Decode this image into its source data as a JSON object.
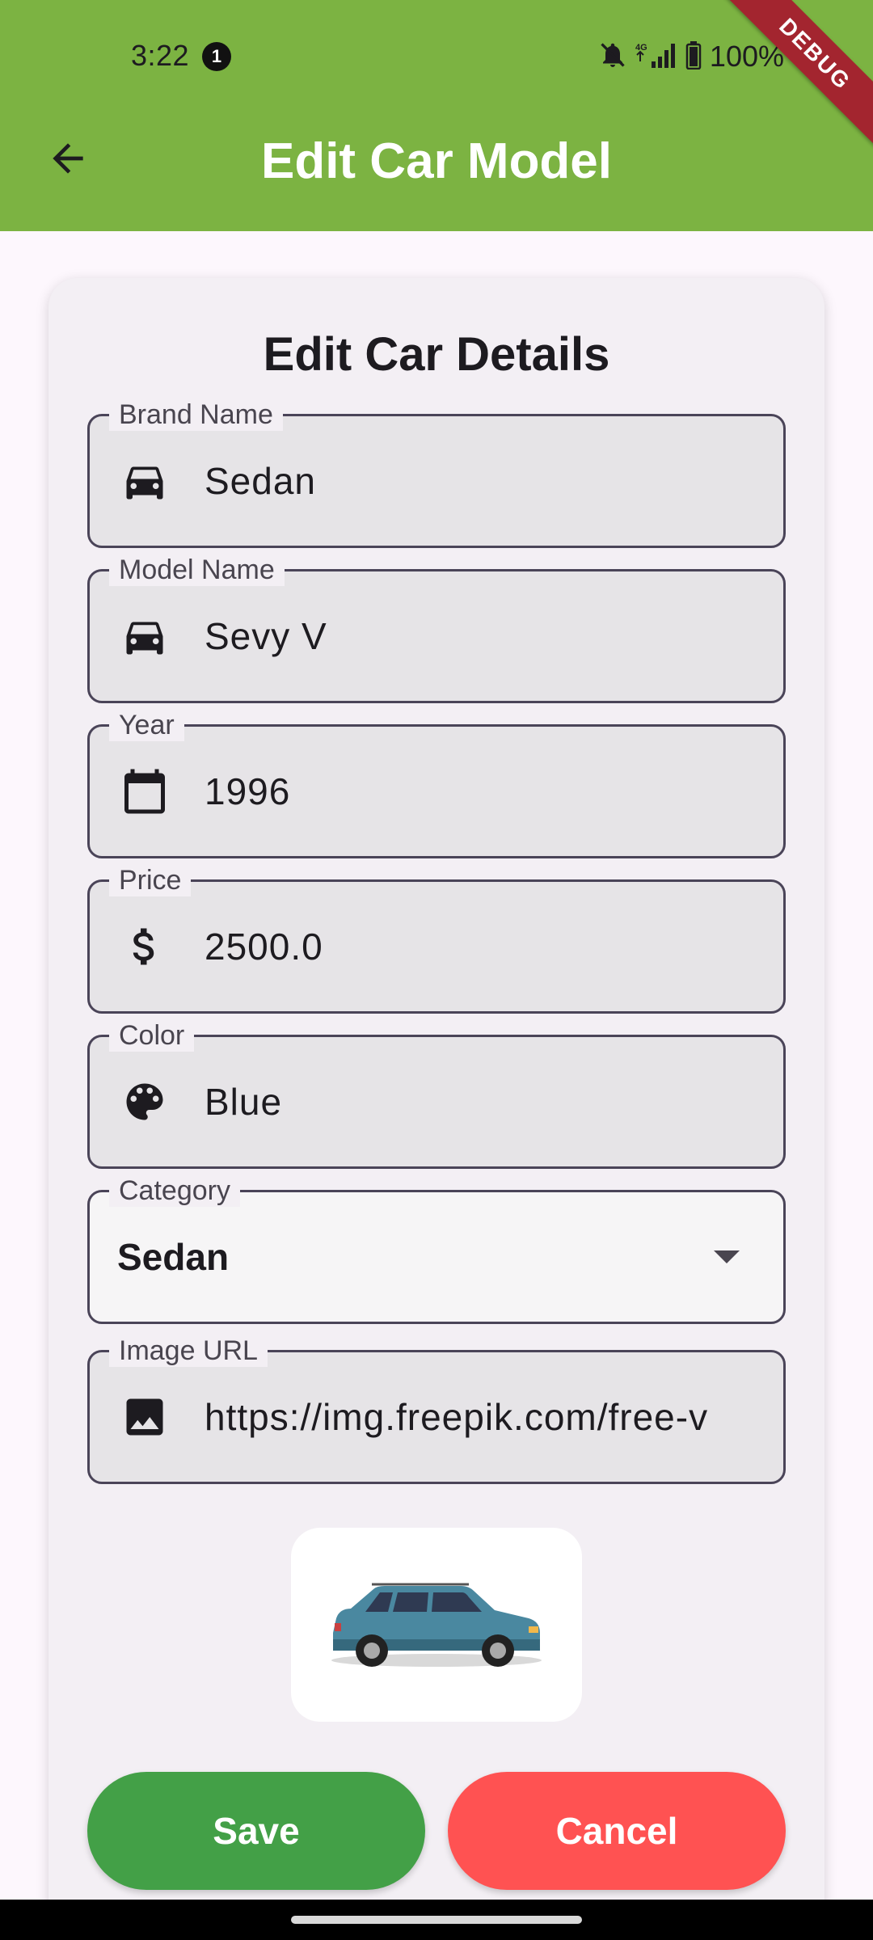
{
  "status_bar": {
    "time": "3:22",
    "notification_count": "1",
    "network": "4G",
    "battery": "100%"
  },
  "app_bar": {
    "title": "Edit Car Model",
    "debug_banner": "DEBUG",
    "back_icon": "arrow-back-icon",
    "color": "#7cb342"
  },
  "form": {
    "title": "Edit Car Details",
    "fields": [
      {
        "label": "Brand Name",
        "value": "Sedan",
        "icon": "car-icon"
      },
      {
        "label": "Model Name",
        "value": "Sevy V",
        "icon": "car-icon"
      },
      {
        "label": "Year",
        "value": "1996",
        "icon": "calendar-icon"
      },
      {
        "label": "Price",
        "value": "2500.0",
        "icon": "dollar-icon"
      },
      {
        "label": "Color",
        "value": "Blue",
        "icon": "palette-icon"
      }
    ],
    "category": {
      "label": "Category",
      "value": "Sedan"
    },
    "image_url": {
      "label": "Image URL",
      "value": "https://img.freepik.com/free-v",
      "icon": "image-icon"
    }
  },
  "preview": {
    "image": "blue-suv-car-image"
  },
  "actions": {
    "save_label": "Save",
    "cancel_label": "Cancel",
    "save_color": "#43a047",
    "cancel_color": "#ff5252"
  }
}
